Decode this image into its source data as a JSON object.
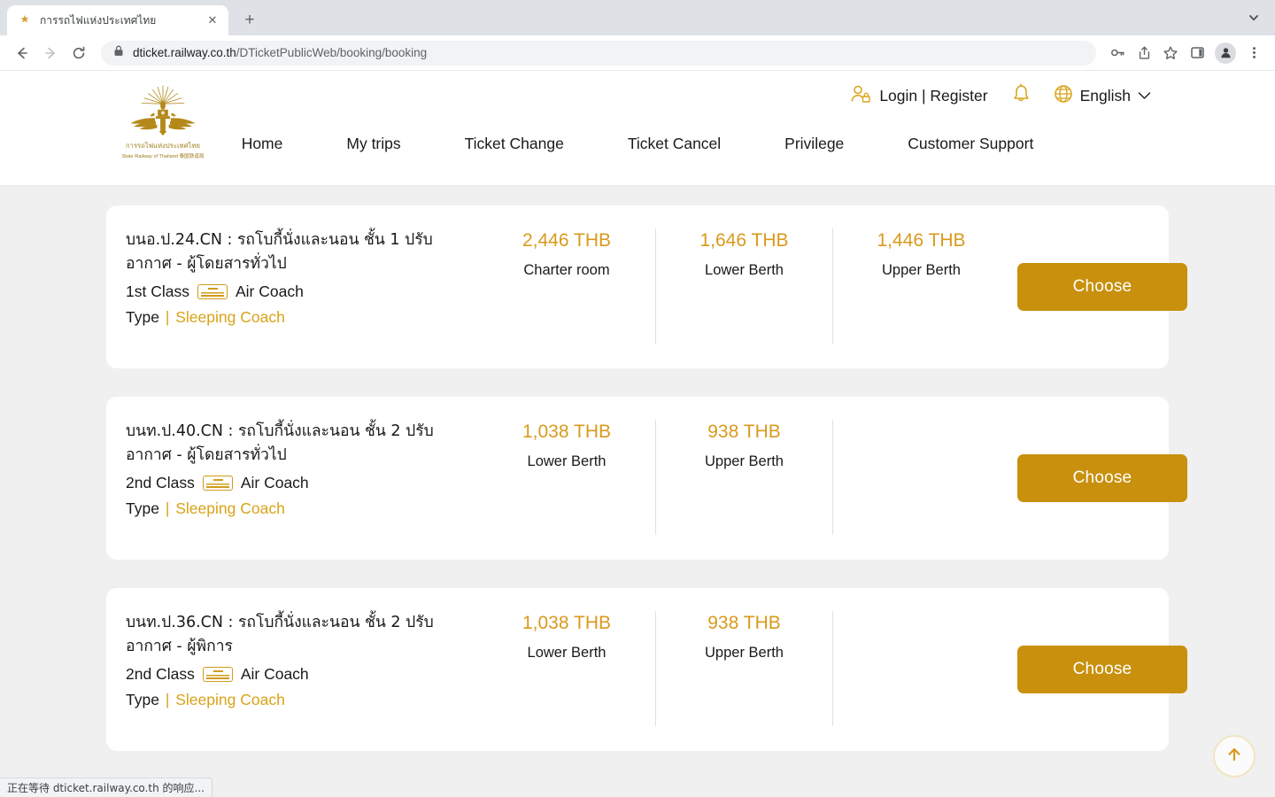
{
  "browser": {
    "tab": {
      "title": "การรถไฟแห่งประเทศไทย",
      "favicon": "railway-logo-icon",
      "close": "✕"
    },
    "new_tab_label": "+",
    "tab_list_icon": "chevron-down-icon",
    "nav": {
      "back": "←",
      "forward": "→",
      "reload": "⟳"
    },
    "omnibox": {
      "lock_icon": "lock-icon",
      "url_domain": "dticket.railway.co.th",
      "url_path": "/DTicketPublicWeb/booking/booking"
    },
    "toolbar_icons": [
      "key-icon",
      "share-icon",
      "star-icon",
      "sidepanel-icon",
      "profile-icon",
      "menu-icon"
    ],
    "status_text": "正在等待 dticket.railway.co.th 的响应..."
  },
  "site": {
    "logo": {
      "alt": "state-railway-of-thailand-emblem",
      "text_th": "การรถไฟแห่งประเทศไทย",
      "text_en": "State Railway of Thailand 泰国铁道局"
    },
    "utility": {
      "login_label": "Login | Register",
      "user_icon": "user-lock-icon",
      "bell_icon": "bell-icon",
      "globe_icon": "globe-icon",
      "language": "English",
      "chevron": "chevron-down-icon"
    },
    "nav_items": [
      {
        "label": "Home"
      },
      {
        "label": "My trips"
      },
      {
        "label": "Ticket Change"
      },
      {
        "label": "Ticket Cancel"
      },
      {
        "label": "Privilege"
      },
      {
        "label": "Customer Support"
      }
    ]
  },
  "colors": {
    "gold": "#d8a317",
    "price_gold": "#d99a1c",
    "button_gold": "#c8900c",
    "page_bg": "#f0f0f0",
    "card_bg": "#ffffff"
  },
  "results": {
    "choose_label": "Choose",
    "type_label": "Type",
    "type_separator": "|",
    "air_coach_label": "Air Coach",
    "cards": [
      {
        "title": "บนอ.ป.24.CN : รถโบกี้นั่งและนอน ชั้น 1 ปรับอากาศ - ผู้โดยสารทั่วไป",
        "class": "1st Class",
        "amenity": "Air Coach",
        "type_value": "Sleeping Coach",
        "fares": [
          {
            "price": "2,446 THB",
            "label": "Charter room"
          },
          {
            "price": "1,646 THB",
            "label": "Lower Berth"
          },
          {
            "price": "1,446 THB",
            "label": "Upper Berth"
          }
        ],
        "choose": "Choose"
      },
      {
        "title": "บนท.ป.40.CN : รถโบกี้นั่งและนอน ชั้น 2 ปรับอากาศ - ผู้โดยสารทั่วไป",
        "class": "2nd Class",
        "amenity": "Air Coach",
        "type_value": "Sleeping Coach",
        "fares": [
          {
            "price": "1,038 THB",
            "label": "Lower Berth"
          },
          {
            "price": "938 THB",
            "label": "Upper Berth"
          }
        ],
        "choose": "Choose"
      },
      {
        "title": "บนท.ป.36.CN : รถโบกี้นั่งและนอน ชั้น 2 ปรับอากาศ - ผู้พิการ",
        "class": "2nd Class",
        "amenity": "Air Coach",
        "type_value": "Sleeping Coach",
        "fares": [
          {
            "price": "1,038 THB",
            "label": "Lower Berth"
          },
          {
            "price": "938 THB",
            "label": "Upper Berth"
          }
        ],
        "choose": "Choose"
      }
    ]
  },
  "scroll_top": {
    "icon": "arrow-up-icon"
  }
}
